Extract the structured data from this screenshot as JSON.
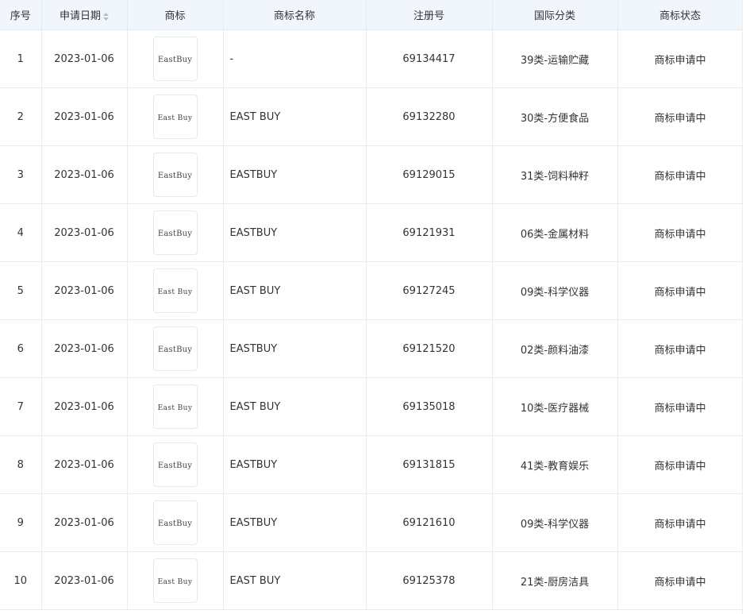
{
  "header": {
    "index": "序号",
    "date": "申请日期",
    "logo": "商标",
    "name": "商标名称",
    "reg_no": "注册号",
    "intl_class": "国际分类",
    "status": "商标状态"
  },
  "rows": [
    {
      "index": "1",
      "date": "2023-01-06",
      "logo_text": "EastBuy",
      "name": "-",
      "reg_no": "69134417",
      "intl_class": "39类-运输贮藏",
      "status": "商标申请中"
    },
    {
      "index": "2",
      "date": "2023-01-06",
      "logo_text": "East Buy",
      "name": "EAST BUY",
      "reg_no": "69132280",
      "intl_class": "30类-方便食品",
      "status": "商标申请中"
    },
    {
      "index": "3",
      "date": "2023-01-06",
      "logo_text": "EastBuy",
      "name": "EASTBUY",
      "reg_no": "69129015",
      "intl_class": "31类-饲料种籽",
      "status": "商标申请中"
    },
    {
      "index": "4",
      "date": "2023-01-06",
      "logo_text": "EastBuy",
      "name": "EASTBUY",
      "reg_no": "69121931",
      "intl_class": "06类-金属材料",
      "status": "商标申请中"
    },
    {
      "index": "5",
      "date": "2023-01-06",
      "logo_text": "East Buy",
      "name": "EAST BUY",
      "reg_no": "69127245",
      "intl_class": "09类-科学仪器",
      "status": "商标申请中"
    },
    {
      "index": "6",
      "date": "2023-01-06",
      "logo_text": "EastBuy",
      "name": "EASTBUY",
      "reg_no": "69121520",
      "intl_class": "02类-颜料油漆",
      "status": "商标申请中"
    },
    {
      "index": "7",
      "date": "2023-01-06",
      "logo_text": "East Buy",
      "name": "EAST BUY",
      "reg_no": "69135018",
      "intl_class": "10类-医疗器械",
      "status": "商标申请中"
    },
    {
      "index": "8",
      "date": "2023-01-06",
      "logo_text": "EastBuy",
      "name": "EASTBUY",
      "reg_no": "69131815",
      "intl_class": "41类-教育娱乐",
      "status": "商标申请中"
    },
    {
      "index": "9",
      "date": "2023-01-06",
      "logo_text": "EastBuy",
      "name": "EASTBUY",
      "reg_no": "69121610",
      "intl_class": "09类-科学仪器",
      "status": "商标申请中"
    },
    {
      "index": "10",
      "date": "2023-01-06",
      "logo_text": "East Buy",
      "name": "EAST BUY",
      "reg_no": "69125378",
      "intl_class": "21类-厨房洁具",
      "status": "商标申请中"
    }
  ],
  "icons": {
    "sort": "sort-icon"
  },
  "colors": {
    "header_bg": "#f0f6fc",
    "border": "#e8edf2",
    "text": "#333333"
  }
}
